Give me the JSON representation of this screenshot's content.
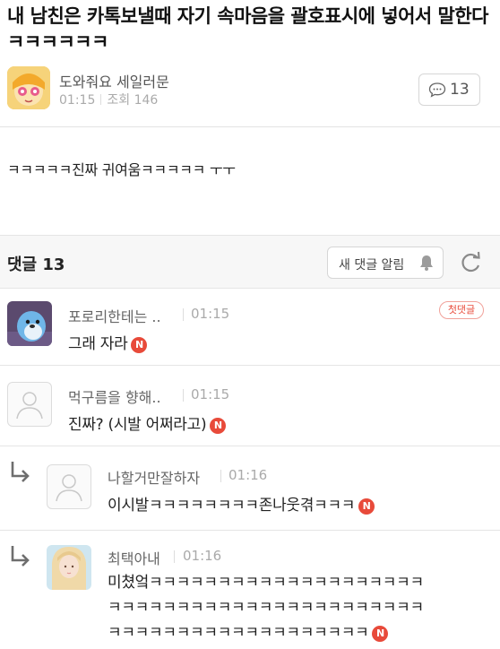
{
  "post": {
    "title": "내 남친은 카톡보낼때 자기 속마음을 괄호표시에 넣어서 말한다 ㅋㅋㅋㅋㅋㅋ",
    "author": "도와줘요 세일러문",
    "time": "01:15",
    "views": "조회 146",
    "comment_count": "13",
    "body": "ㅋㅋㅋㅋㅋ진짜 귀여움ㅋㅋㅋㅋㅋ ㅜㅜ"
  },
  "comments_header": {
    "label": "댓글 13",
    "notify_label": "새 댓글 알림"
  },
  "badges": {
    "new": "N",
    "first": "첫댓글"
  },
  "comments": [
    {
      "nick": "포로리한테는 ..",
      "time": "01:15",
      "text": "그래 자라"
    },
    {
      "nick": "먹구름을 향해..",
      "time": "01:15",
      "text": "진짜? (시발 어쩌라고)"
    },
    {
      "nick": "나할거만잘하자",
      "time": "01:16",
      "text": "이시발ㅋㅋㅋㅋㅋㅋㅋㅋ존나웃겪ㅋㅋㅋ"
    },
    {
      "nick": "최택아내",
      "time": "01:16",
      "lines": [
        "미쳤엌ㅋㅋㅋㅋㅋㅋㅋㅋㅋㅋㅋㅋㅋㅋㅋㅋㅋㅋㅋㅋ",
        "ㅋㅋㅋㅋㅋㅋㅋㅋㅋㅋㅋㅋㅋㅋㅋㅋㅋㅋㅋㅋㅋㅋㅋ",
        "ㅋㅋㅋㅋㅋㅋㅋㅋㅋㅋㅋㅋㅋㅋㅋㅋㅋㅋㅋ"
      ]
    }
  ],
  "colors": {
    "accent_red": "#e84a3a",
    "divider": "#e3e3e3",
    "header_bg": "#f7f7f7"
  },
  "icons": {
    "comment": "speech-bubble-icon",
    "notify": "bell-icon",
    "refresh": "refresh-icon",
    "reply": "reply-arrow-icon",
    "default_avatar": "person-outline-icon"
  }
}
